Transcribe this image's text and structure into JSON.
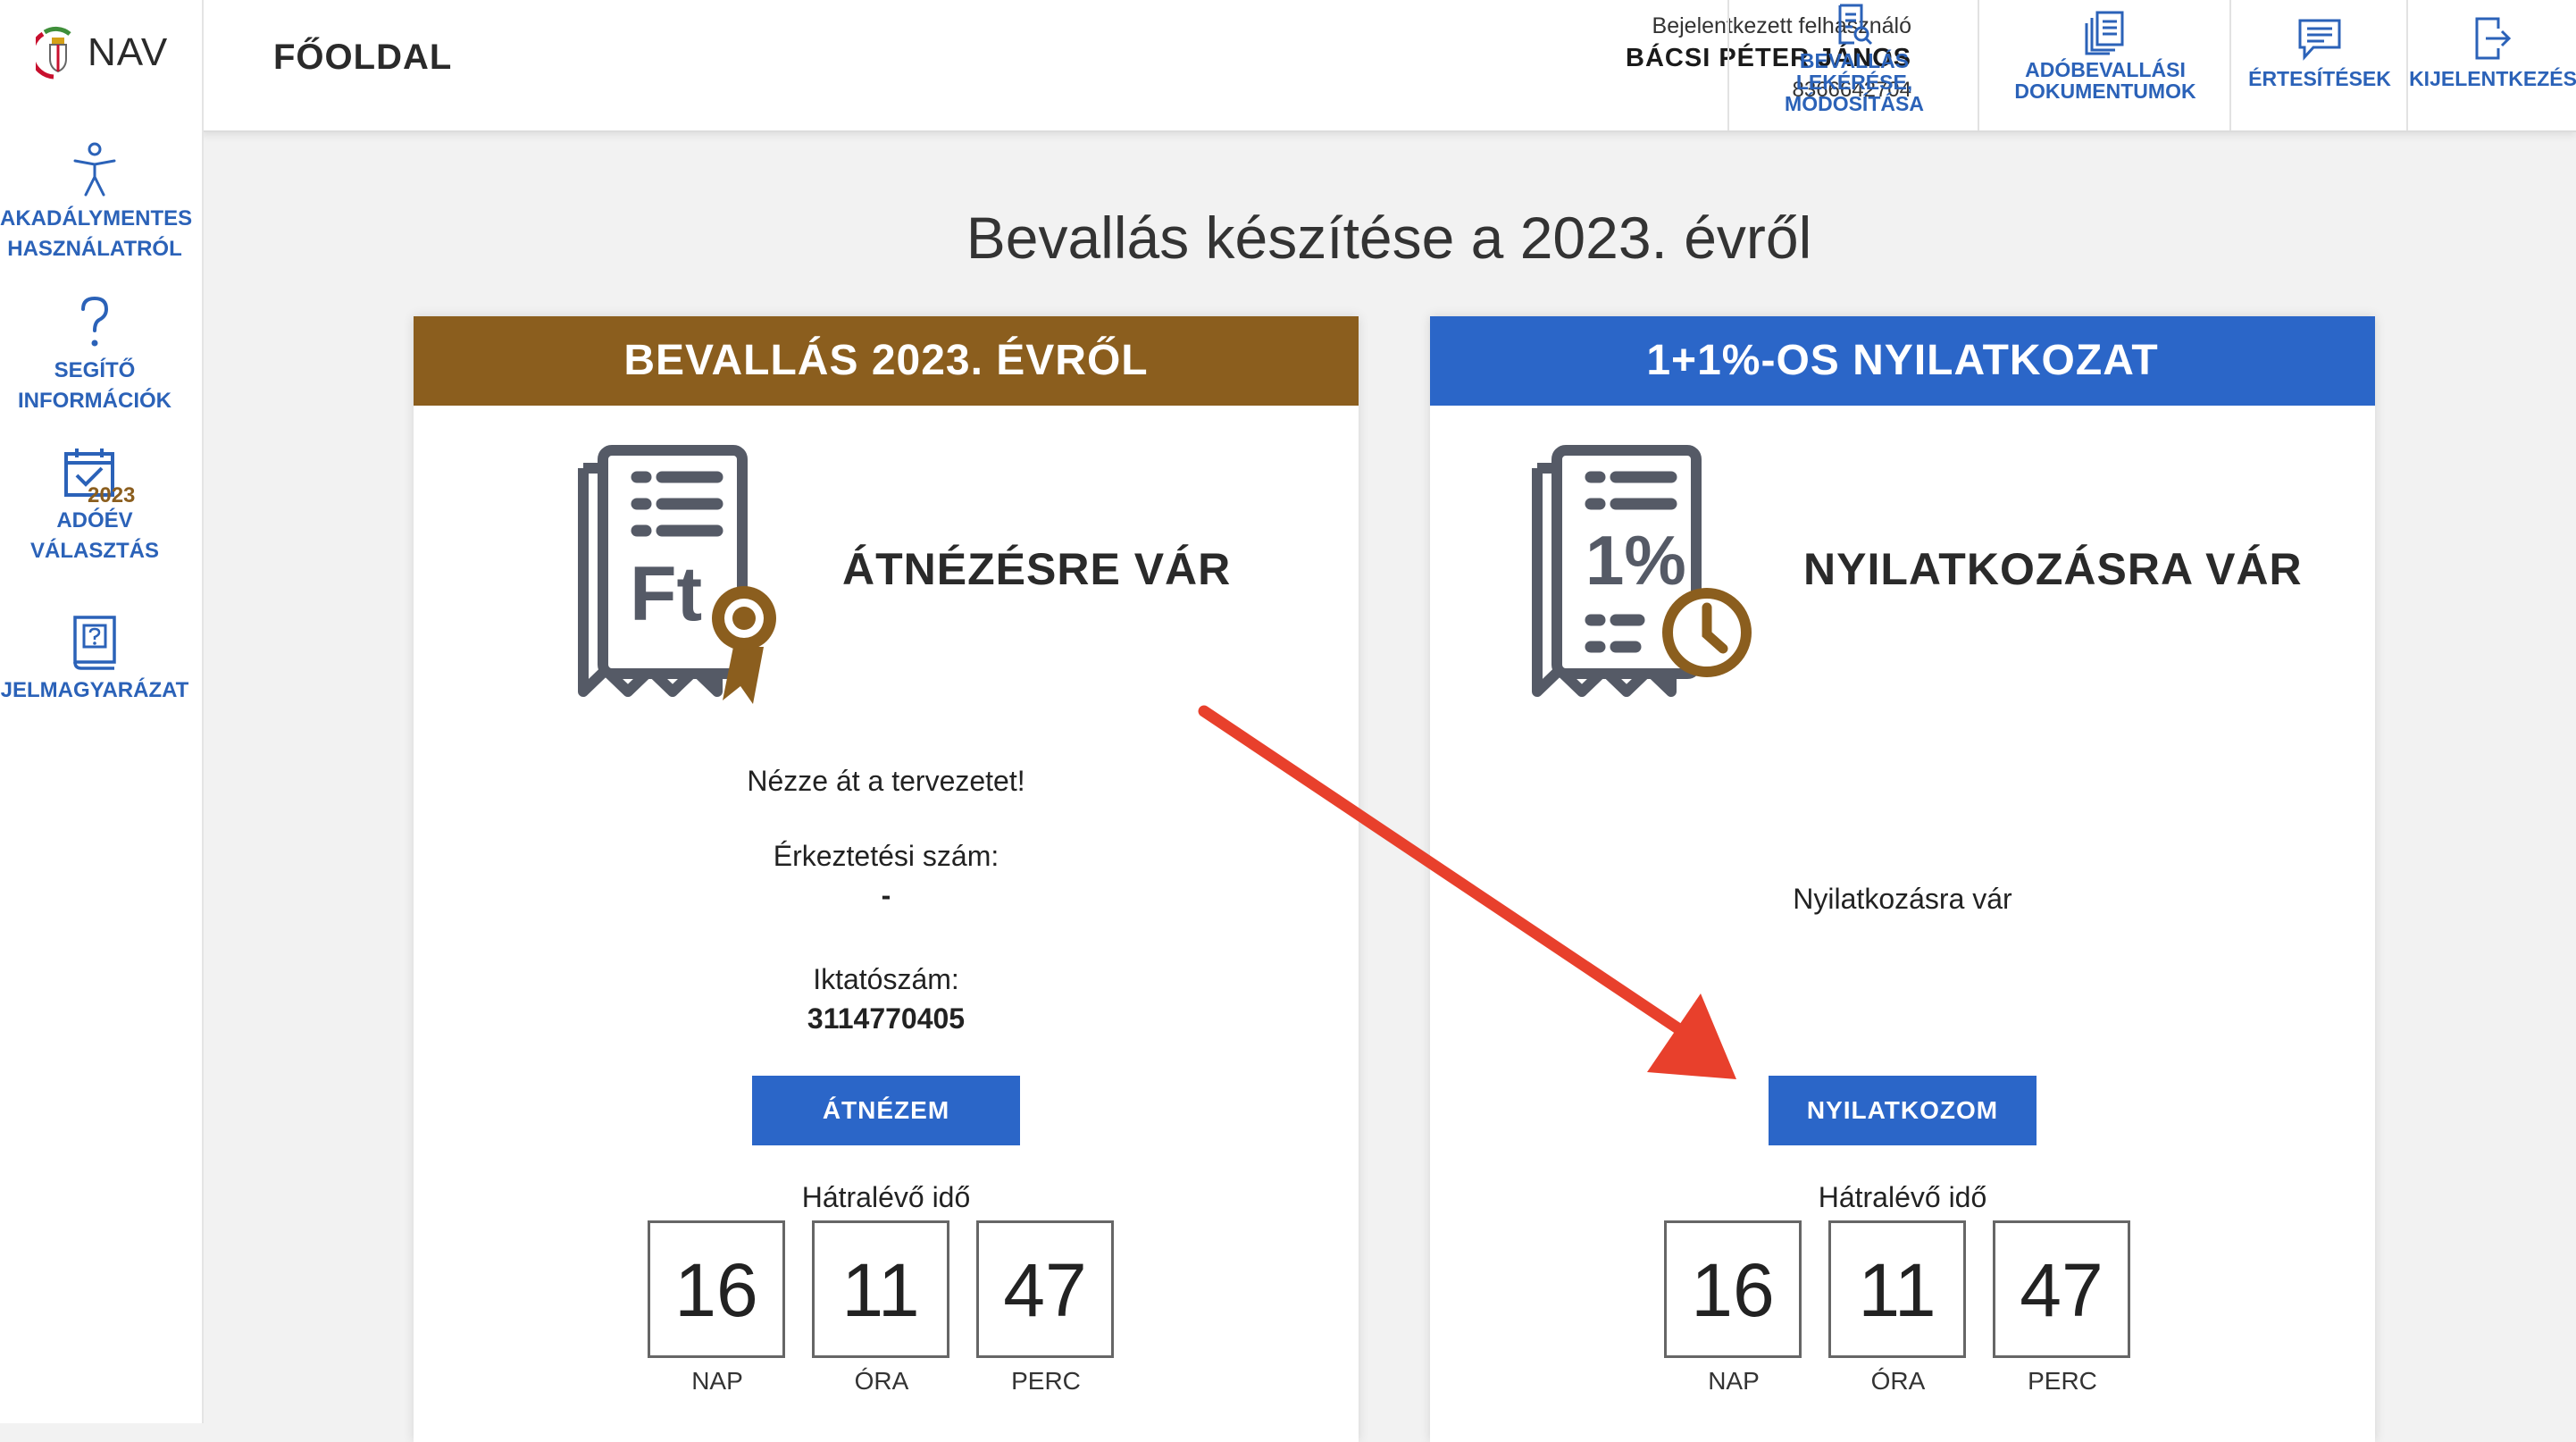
{
  "app": {
    "logo_text": "NAV",
    "page_title": "FŐOLDAL"
  },
  "user": {
    "label": "Bejelentkezett felhasználó",
    "name": "BÁCSI PÉTER JÁNOS",
    "id": "8366642704"
  },
  "header_nav": [
    {
      "label": "BEVALLÁS LEKÉRÉSE, MÓDOSÍTÁSA",
      "icon": "document-search-icon"
    },
    {
      "label": "ADÓBEVALLÁSI DOKUMENTUMOK",
      "icon": "documents-icon"
    },
    {
      "label": "ÉRTESÍTÉSEK",
      "icon": "message-icon"
    },
    {
      "label": "KIJELENTKEZÉS",
      "icon": "logout-icon"
    }
  ],
  "sidebar": [
    {
      "label": "AKADÁLYMENTES HASZNÁLATRÓL",
      "icon": "accessibility-icon"
    },
    {
      "label": "SEGÍTŐ INFORMÁCIÓK",
      "icon": "question-icon"
    },
    {
      "label": "ADÓÉV VÁLASZTÁS",
      "icon": "calendar-icon",
      "badge": "2023"
    },
    {
      "label": "JELMAGYARÁZAT",
      "icon": "legend-book-icon"
    }
  ],
  "main_title": "Bevallás készítése a 2023. évről",
  "cards": [
    {
      "header": "BEVALLÁS 2023. ÉVRŐL",
      "header_color": "#8b5e1e",
      "status": "ÁTNÉZÉSRE VÁR",
      "icon": "tax-document-award-icon",
      "icon_text": "Ft",
      "message": "Nézze át a tervezetet!",
      "arrival_label": "Érkeztetési szám:",
      "arrival_value": "-",
      "file_label": "Iktatószám:",
      "file_value": "3114770405",
      "button": "ÁTNÉZEM",
      "remaining_label": "Hátralévő idő",
      "timer": [
        {
          "value": "16",
          "unit": "NAP"
        },
        {
          "value": "11",
          "unit": "ÓRA"
        },
        {
          "value": "47",
          "unit": "PERC"
        }
      ]
    },
    {
      "header": "1+1%-OS NYILATKOZAT",
      "header_color": "#2b66c8",
      "status": "NYILATKOZÁSRA VÁR",
      "icon": "one-percent-document-clock-icon",
      "icon_text": "1%",
      "message": "Nyilatkozásra vár",
      "button": "NYILATKOZOM",
      "remaining_label": "Hátralévő idő",
      "timer": [
        {
          "value": "16",
          "unit": "NAP"
        },
        {
          "value": "11",
          "unit": "ÓRA"
        },
        {
          "value": "47",
          "unit": "PERC"
        }
      ]
    }
  ],
  "colors": {
    "accent_blue": "#2b66c8",
    "brown": "#8b5e1e",
    "arrow_red": "#e8402c"
  }
}
